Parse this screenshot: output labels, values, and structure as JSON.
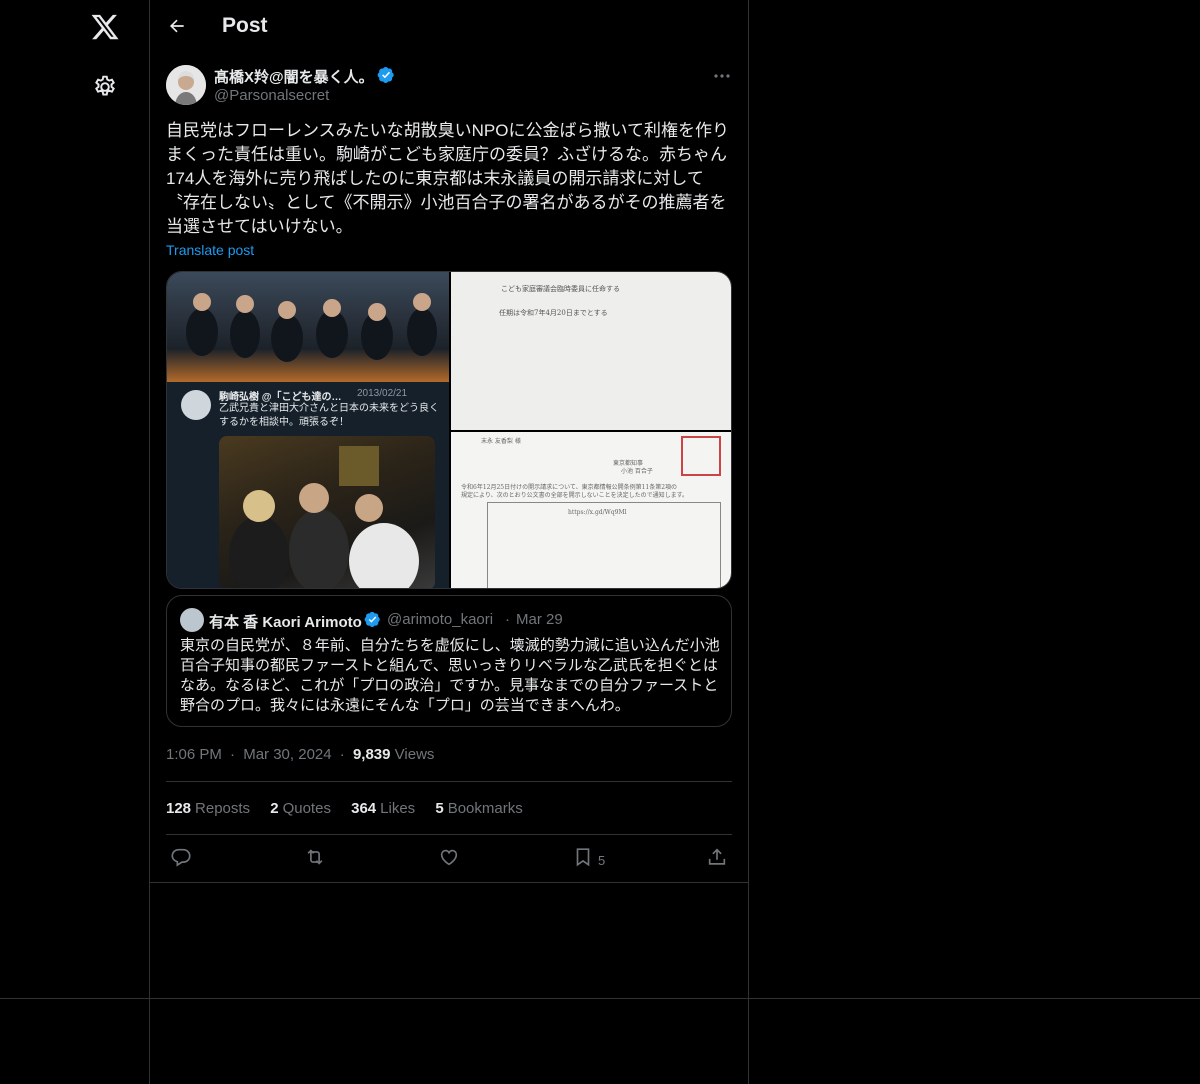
{
  "header": {
    "title": "Post"
  },
  "author": {
    "name": "髙橋X羚@闇を暴く人。",
    "handle": "@Parsonalsecret"
  },
  "post": {
    "text": "自民党はフローレンスみたいな胡散臭いNPOに公金ばら撒いて利権を作りまくった責任は重い。駒崎がこども家庭庁の委員？ふざけるな。赤ちゃん174人を海外に売り飛ばしたのに東京都は末永議員の開示請求に対して〝存在しない〟として《不開示》小池百合子の署名があるがその推薦者を当選させてはいけない。",
    "translate_label": "Translate post"
  },
  "media": {
    "embedded_tweet": {
      "name": "駒崎弘樹 @「こども達の…",
      "date": "2013/02/21",
      "text": "乙武兄貴と津田大介さんと日本の未来をどう良くするかを相談中。頑張るぞ！"
    },
    "doc1": {
      "line1": "こども家庭審議会臨時委員に任命する",
      "line2": "任期は令和7年4月20日までとする"
    },
    "doc2": {
      "line1": "末永 友香梨 様",
      "line2": "東京都知事",
      "line3": "小池 百合子",
      "line4": "令和6年12月25日付けの開示請求について、東京都情報公開条例第11条第2項の",
      "line5": "規定により、次のとおり公文書の全部を開示しないことを決定したので通知します。",
      "url": "https://x.gd/Wq9Ml"
    }
  },
  "quote": {
    "name": "有本 香 Kaori Arimoto",
    "handle": "@arimoto_kaori",
    "dot": "·",
    "date": "Mar 29",
    "text": "東京の自民党が、８年前、自分たちを虚仮にし、壊滅的勢力減に追い込んだ小池百合子知事の都民ファーストと組んで、思いっきりリベラルな乙武氏を担ぐとはなあ。なるほど、これが「プロの政治」ですか。見事なまでの自分ファーストと野合のプロ。我々には永遠にそんな「プロ」の芸当できまへんわ。"
  },
  "meta": {
    "time": "1:06 PM",
    "sep1": "·",
    "date": "Mar 30, 2024",
    "sep2": "·",
    "views_count": "9,839",
    "views_label": "Views"
  },
  "stats": {
    "reposts_count": "128",
    "reposts_label": "Reposts",
    "quotes_count": "2",
    "quotes_label": "Quotes",
    "likes_count": "364",
    "likes_label": "Likes",
    "bookmarks_count": "5",
    "bookmarks_label": "Bookmarks"
  },
  "actions": {
    "bookmark_count": "5"
  },
  "colors": {
    "background": "#000000",
    "text": "#e7e9ea",
    "muted": "#71767b",
    "accent": "#1d9bf0",
    "border": "#2f3336"
  },
  "icons": [
    "x-logo-icon",
    "gear-icon",
    "back-arrow-icon",
    "verified-icon",
    "more-icon",
    "reply-icon",
    "repost-icon",
    "like-icon",
    "bookmark-icon",
    "share-icon"
  ]
}
